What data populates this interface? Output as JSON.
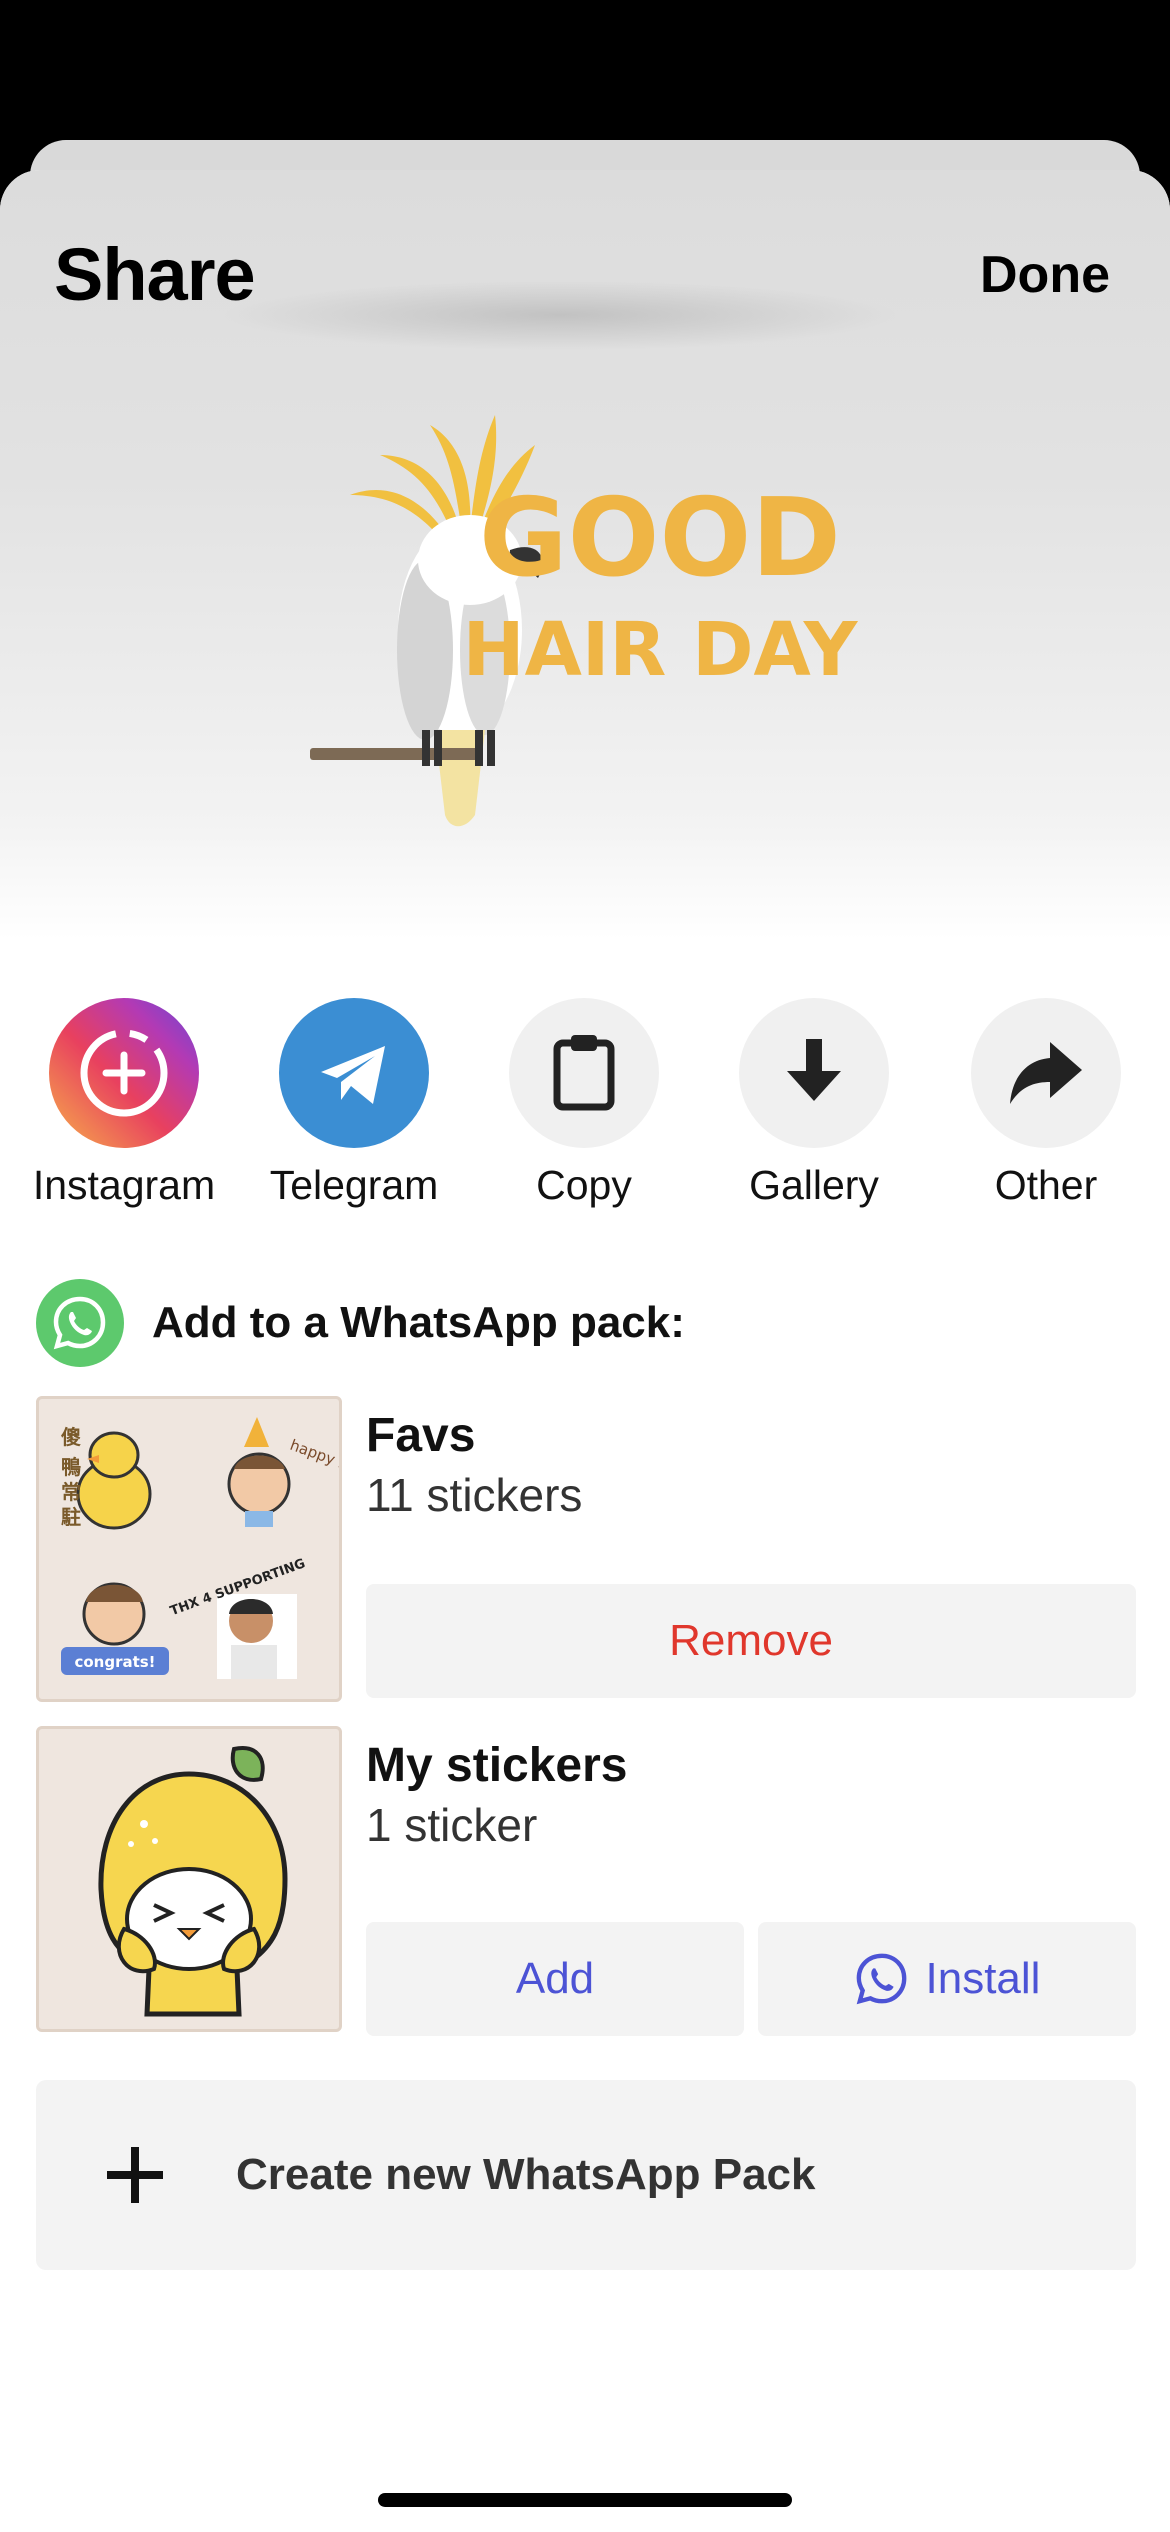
{
  "header": {
    "title": "Share",
    "done_label": "Done"
  },
  "preview": {
    "sticker_text_line1": "GOOD",
    "sticker_text_line2": "HAIR DAY",
    "sticker_color": "#efb545"
  },
  "targets": [
    {
      "label": "Instagram",
      "icon": "instagram-story-icon"
    },
    {
      "label": "Telegram",
      "icon": "telegram-icon"
    },
    {
      "label": "Copy",
      "icon": "clipboard-icon"
    },
    {
      "label": "Gallery",
      "icon": "download-arrow-icon"
    },
    {
      "label": "Other",
      "icon": "share-arrow-icon"
    }
  ],
  "whatsapp": {
    "title": "Add to a WhatsApp pack:",
    "packs": [
      {
        "name": "Favs",
        "count": "11 stickers",
        "button": "Remove"
      },
      {
        "name": "My stickers",
        "count": "1 sticker",
        "add_label": "Add",
        "install_label": "Install"
      }
    ],
    "thumb_labels": {
      "happy": "happy birth-day!",
      "thx": "THX 4 SUPPORTING",
      "congrats": "congrats!"
    },
    "create_label": "Create new WhatsApp Pack"
  },
  "colors": {
    "accent": "#4c53d5",
    "danger": "#e0372c",
    "whatsapp": "#5dc96d",
    "telegram": "#3b8ed3"
  }
}
